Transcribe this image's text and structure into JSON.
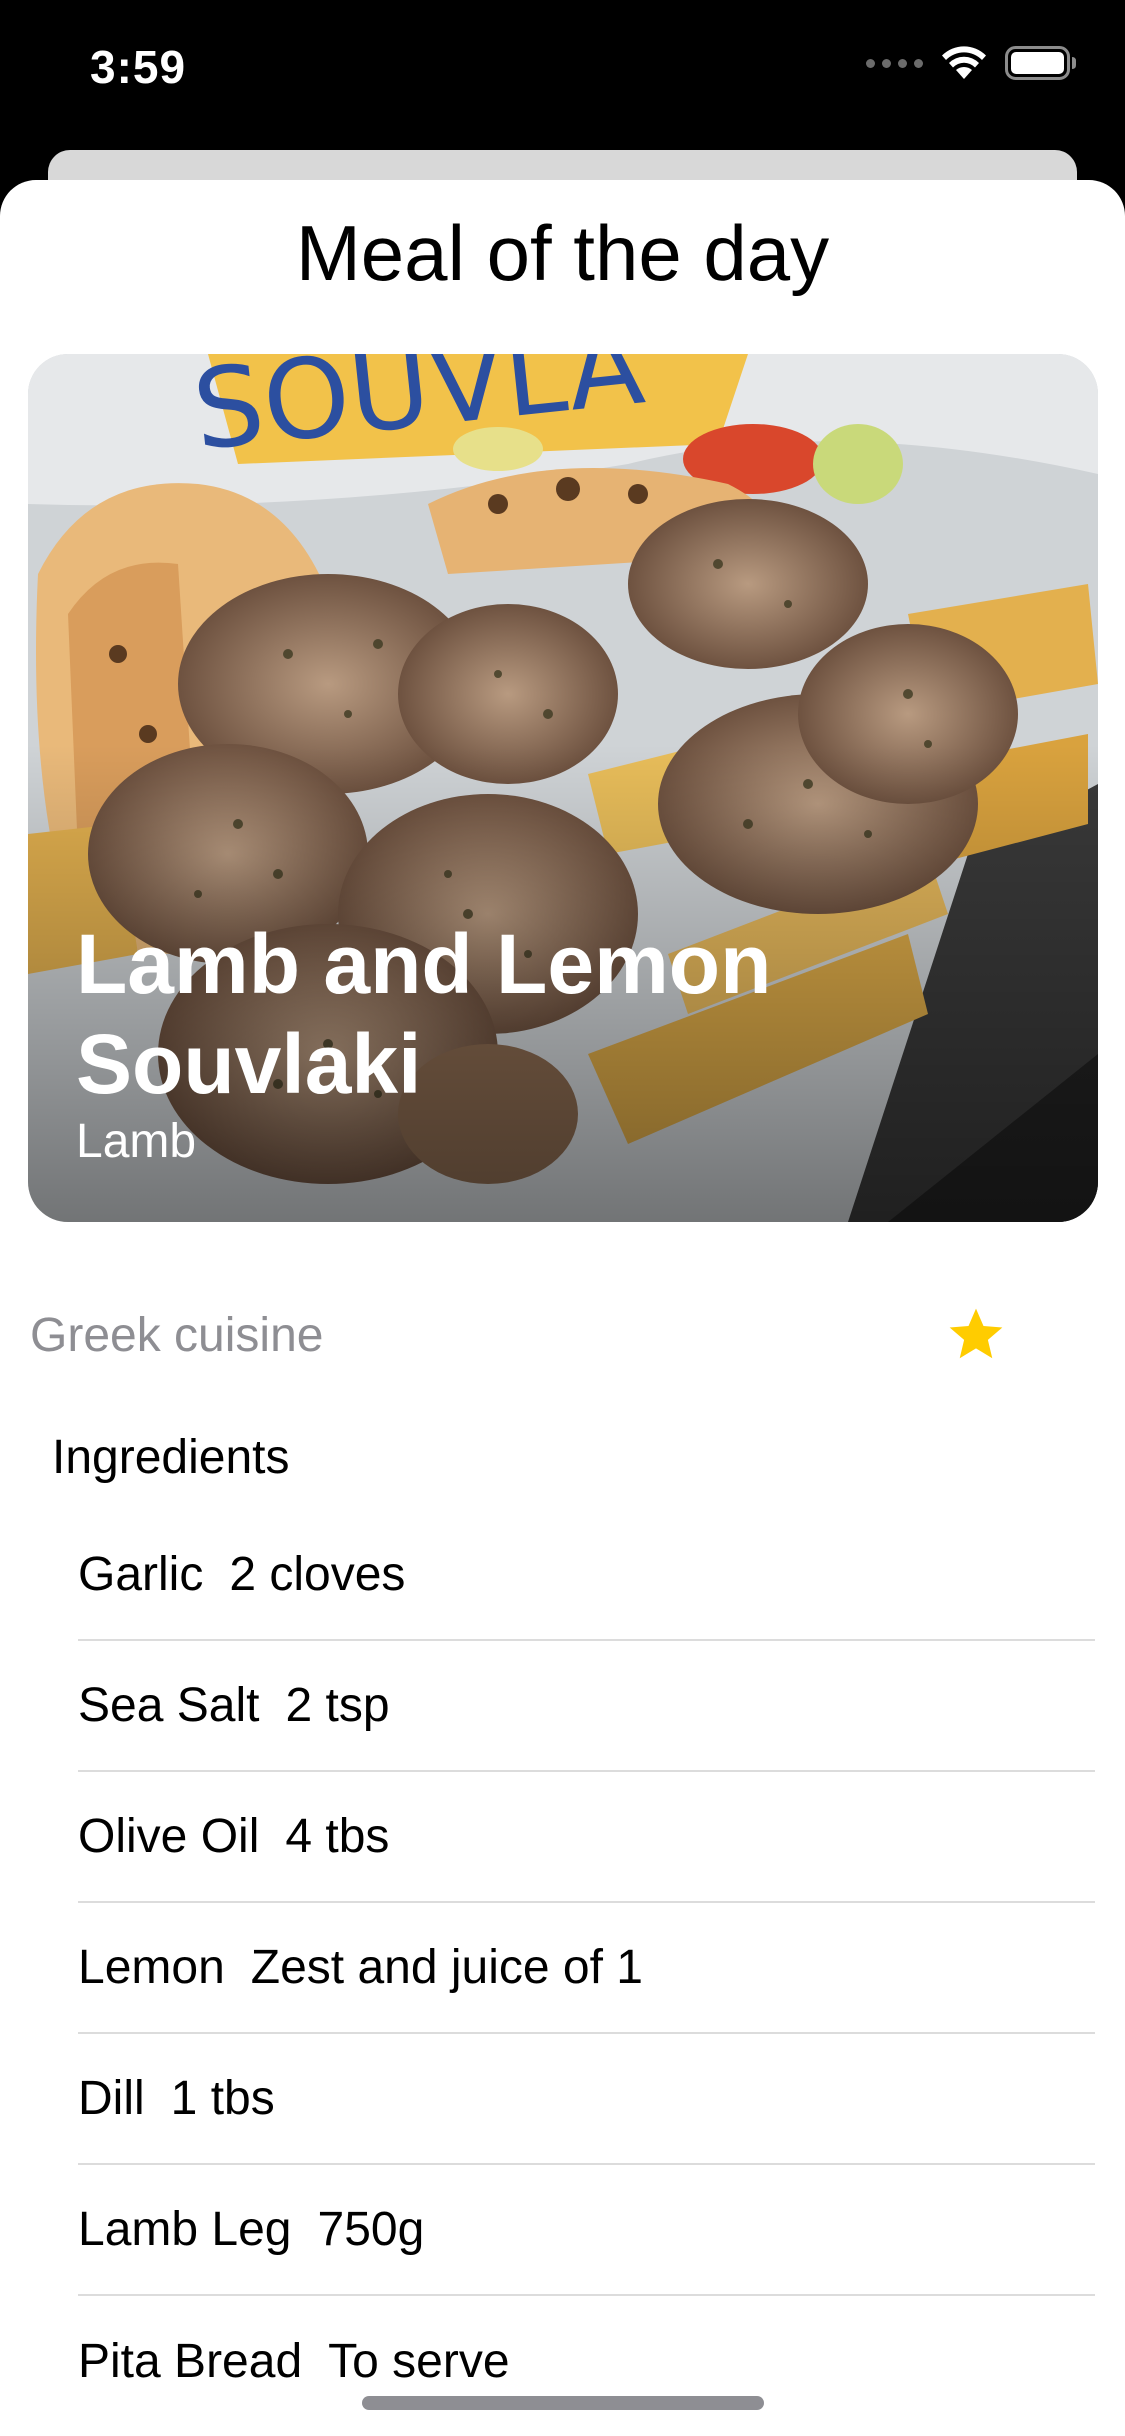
{
  "status_bar": {
    "time": "3:59"
  },
  "sheet": {
    "title": "Meal of the day"
  },
  "meal": {
    "name": "Lamb and Lemon Souvlaki",
    "category": "Lamb",
    "area": "Greek cuisine",
    "favorite_icon": "star-filled-icon",
    "favorite_color": "#FFCC00"
  },
  "ingredients": {
    "header": "Ingredients",
    "items": [
      {
        "name": "Garlic",
        "measure": "2 cloves"
      },
      {
        "name": "Sea Salt",
        "measure": "2 tsp"
      },
      {
        "name": "Olive Oil",
        "measure": "4 tbs"
      },
      {
        "name": "Lemon",
        "measure": "Zest and juice of 1"
      },
      {
        "name": "Dill",
        "measure": "1 tbs"
      },
      {
        "name": "Lamb Leg",
        "measure": "750g"
      },
      {
        "name": "Pita Bread",
        "measure": "To serve"
      }
    ]
  }
}
